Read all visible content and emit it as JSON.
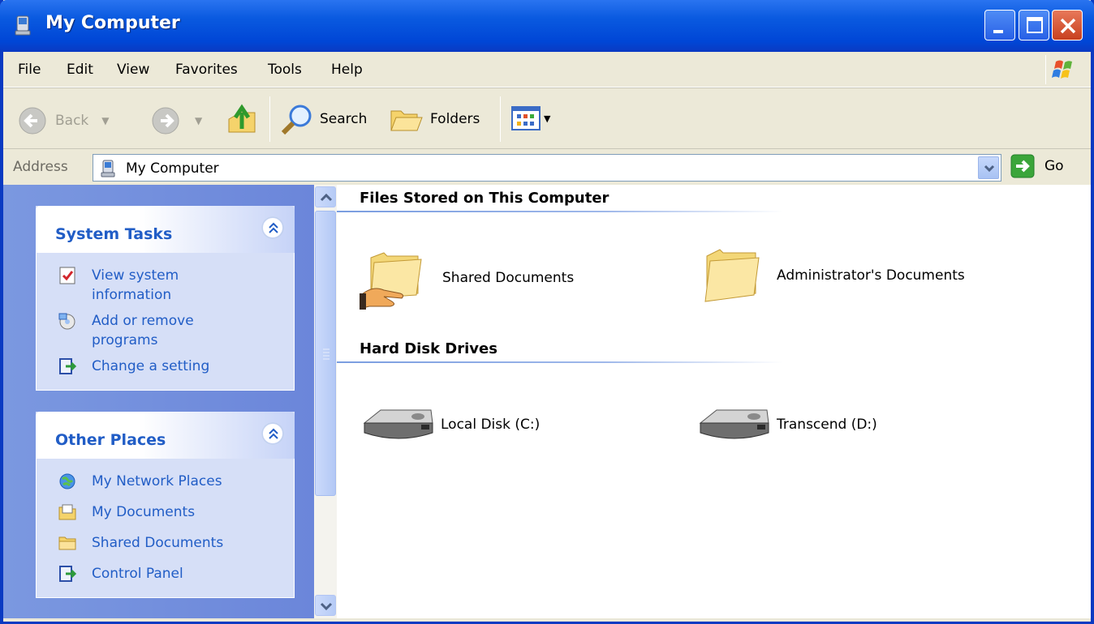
{
  "window": {
    "title": "My Computer"
  },
  "menu": [
    "File",
    "Edit",
    "View",
    "Favorites",
    "Tools",
    "Help"
  ],
  "toolbar": {
    "back_label": "Back",
    "search_label": "Search",
    "folders_label": "Folders"
  },
  "address": {
    "label": "Address",
    "value": "My Computer",
    "go_label": "Go"
  },
  "system_tasks": {
    "title": "System Tasks",
    "items": [
      {
        "line1": "View system",
        "line2": "information",
        "icon": "system-info-icon"
      },
      {
        "line1": "Add or remove",
        "line2": "programs",
        "icon": "add-remove-programs-icon"
      },
      {
        "line1": "Change a setting",
        "line2": "",
        "icon": "control-panel-icon"
      }
    ]
  },
  "other_places": {
    "title": "Other Places",
    "items": [
      {
        "label": "My Network Places",
        "icon": "network-places-icon"
      },
      {
        "label": "My Documents",
        "icon": "my-documents-icon"
      },
      {
        "label": "Shared Documents",
        "icon": "folder-icon"
      },
      {
        "label": "Control Panel",
        "icon": "control-panel-icon"
      }
    ]
  },
  "sections": {
    "files_title": "Files Stored on This Computer",
    "files": [
      "Shared Documents",
      "Administrator's Documents"
    ],
    "drives_title": "Hard Disk Drives",
    "drives": [
      "Local Disk (C:)",
      "Transcend (D:)"
    ]
  }
}
